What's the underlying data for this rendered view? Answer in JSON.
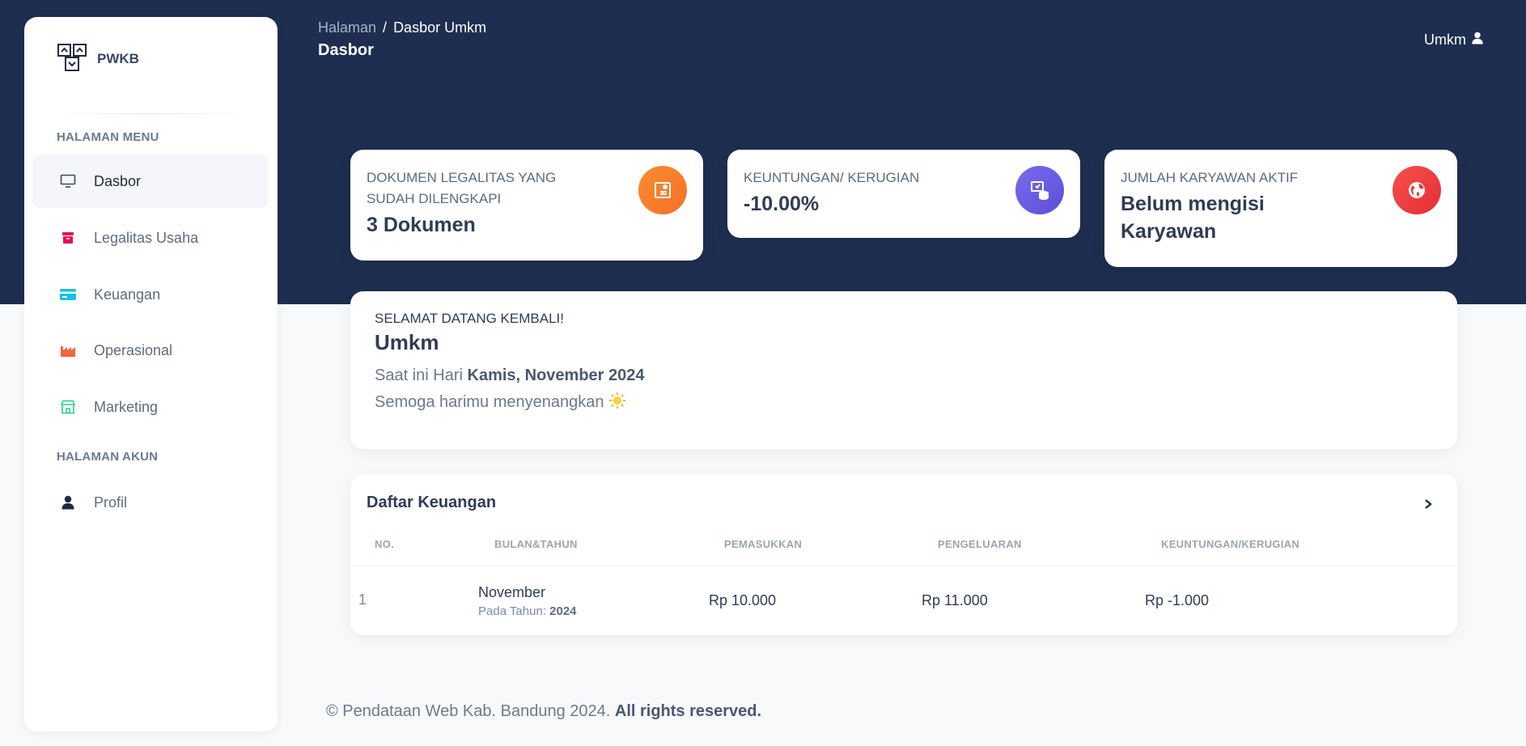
{
  "brand": {
    "name": "PWKB"
  },
  "sidebar": {
    "menu_title": "HALAMAN MENU",
    "items": [
      {
        "label": "Dasbor",
        "icon": "monitor-icon"
      },
      {
        "label": "Legalitas Usaha",
        "icon": "archive-icon"
      },
      {
        "label": "Keuangan",
        "icon": "credit-card-icon"
      },
      {
        "label": "Operasional",
        "icon": "factory-icon"
      },
      {
        "label": "Marketing",
        "icon": "store-icon"
      }
    ],
    "account_title": "HALAMAN AKUN",
    "account_items": [
      {
        "label": "Profil",
        "icon": "user-icon"
      }
    ]
  },
  "header": {
    "breadcrumb_prev": "Halaman",
    "breadcrumb_sep": "/",
    "breadcrumb_current": "Dasbor Umkm",
    "page_title": "Dasbor",
    "user_label": "Umkm"
  },
  "stats": [
    {
      "label": "DOKUMEN LEGALITAS YANG SUDAH DILENGKAPI",
      "value": "3 Dokumen",
      "icon": "document-icon",
      "color": "#f77f22"
    },
    {
      "label": "KEUNTUNGAN/ KERUGIAN",
      "value": "-10.00%",
      "icon": "coins-icon",
      "color": "#6b5ce7"
    },
    {
      "label": "JUMLAH KARYAWAN AKTIF",
      "value": "Belum mengisi Karyawan",
      "icon": "globe-icon",
      "color": "#ef3b3e"
    }
  ],
  "welcome": {
    "kicker": "SELAMAT DATANG KEMBALI!",
    "name": "Umkm",
    "day_prefix": "Saat ini Hari ",
    "day_value": "Kamis, November 2024",
    "wish": "Semoga harimu menyenangkan",
    "wish_emoji": "🌞"
  },
  "finance": {
    "title": "Daftar Keuangan",
    "columns": [
      "NO.",
      "BULAN&TAHUN",
      "PEMASUKKAN",
      "PENGELUARAN",
      "KEUNTUNGAN/KERUGIAN"
    ],
    "rows": [
      {
        "no": "1",
        "month": "November",
        "year_label": "Pada Tahun: ",
        "year": "2024",
        "income": "Rp 10.000",
        "expense": "Rp 11.000",
        "profit": "Rp -1.000"
      }
    ]
  },
  "footer": {
    "text": "© Pendataan Web Kab. Bandung 2024. ",
    "bold": "All rights reserved."
  },
  "colors": {
    "hero": "#1e2e50",
    "orange": "#f77f22",
    "purple": "#6b5ce7",
    "red": "#ef3b3e",
    "cyan": "#17c1e8",
    "green": "#2dce89",
    "pink": "#ea0a56"
  }
}
